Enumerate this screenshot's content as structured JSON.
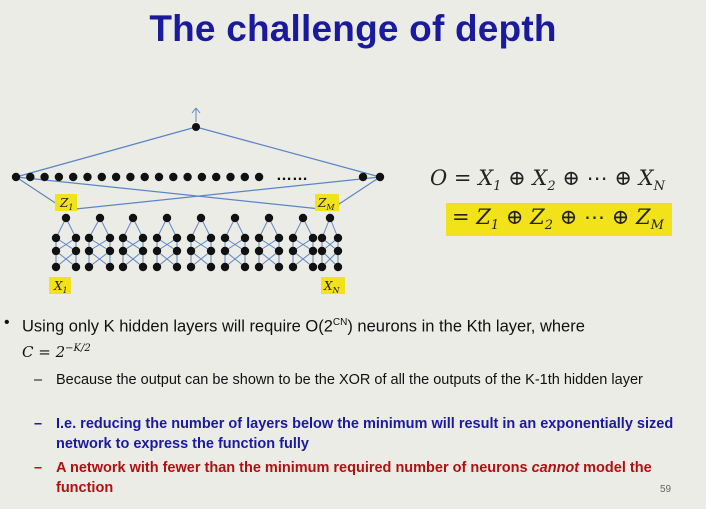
{
  "title": "The challenge of depth",
  "diagram": {
    "labels": {
      "z1": "Z1",
      "zm": "ZM",
      "x1": "X1",
      "xn": "XN",
      "ellipsis": "……"
    }
  },
  "equations": {
    "line1": "O = X1 ⊕ X2 ⊕ ⋯ ⊕ XN",
    "line2": "= Z1 ⊕ Z2 ⊕ ⋯ ⊕ ZM"
  },
  "bullet": {
    "text_before": "Using only K hidden layers will require O(2",
    "superscript": "CN",
    "text_after": ") neurons in the Kth layer, where",
    "formula_c": "C = 2",
    "formula_exp": "−K/2"
  },
  "subbullets": [
    {
      "text": "Because the output can be shown to be the XOR of all the outputs of the K-1th hidden layer"
    },
    {
      "text": "I.e. reducing the number of layers below the minimum will result in an exponentially sized network to express the function fully"
    },
    {
      "text_before": "A network with fewer than the minimum required number of neurons ",
      "emphasis": "cannot",
      "text_after": " model the function"
    }
  ],
  "page_number": "59",
  "colors": {
    "title": "#1a1a9c",
    "highlight": "#f2e21a",
    "blue_text": "#1a1a9c",
    "red_text": "#b01010",
    "edge": "#5b86c4"
  }
}
